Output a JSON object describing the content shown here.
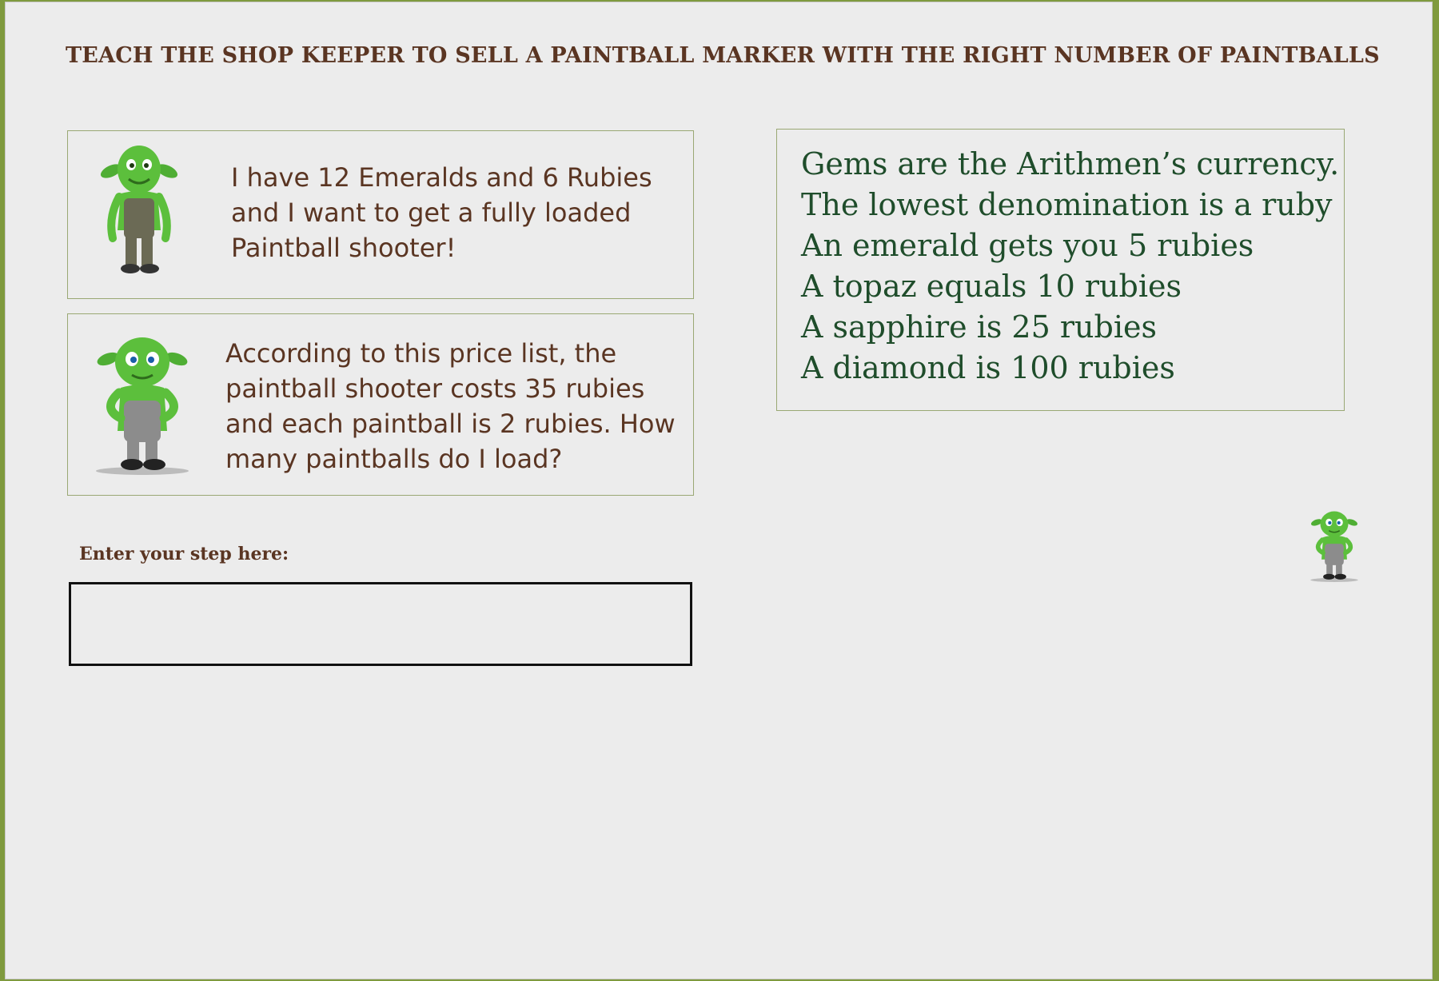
{
  "page": {
    "heading": "TEACH THE SHOP KEEPER TO SELL A PAINTBALL MARKER WITH THE RIGHT NUMBER OF PAINTBALLS"
  },
  "customer": {
    "avatar_icon": "goblin-customer-icon",
    "speech": "I have 12 Emeralds and 6 Rubies and I want to get a fully loaded Paintball shooter!"
  },
  "shopkeeper": {
    "avatar_icon": "goblin-shopkeeper-icon",
    "speech": "According to this price list, the paintball shooter costs 35 rubies and each paintball is 2 rubies. How many paintballs do I load?"
  },
  "currency_info": {
    "lines": [
      "Gems are the Arithmen’s currency.",
      "The lowest denomination is a ruby",
      "An emerald gets you 5 rubies",
      "A topaz equals 10 rubies",
      "A sapphire is 25 rubies",
      "A diamond is 100 rubies"
    ]
  },
  "step_entry": {
    "label": "Enter your step here:",
    "value": "",
    "placeholder": ""
  },
  "helper": {
    "avatar_icon": "goblin-helper-icon"
  },
  "colors": {
    "heading": "#5a3522",
    "speech_text": "#5a3522",
    "currency_text": "#1f4d2b",
    "panel_border": "#9aa874",
    "background": "#ececec",
    "goblin_skin": "#5cbf3c"
  }
}
